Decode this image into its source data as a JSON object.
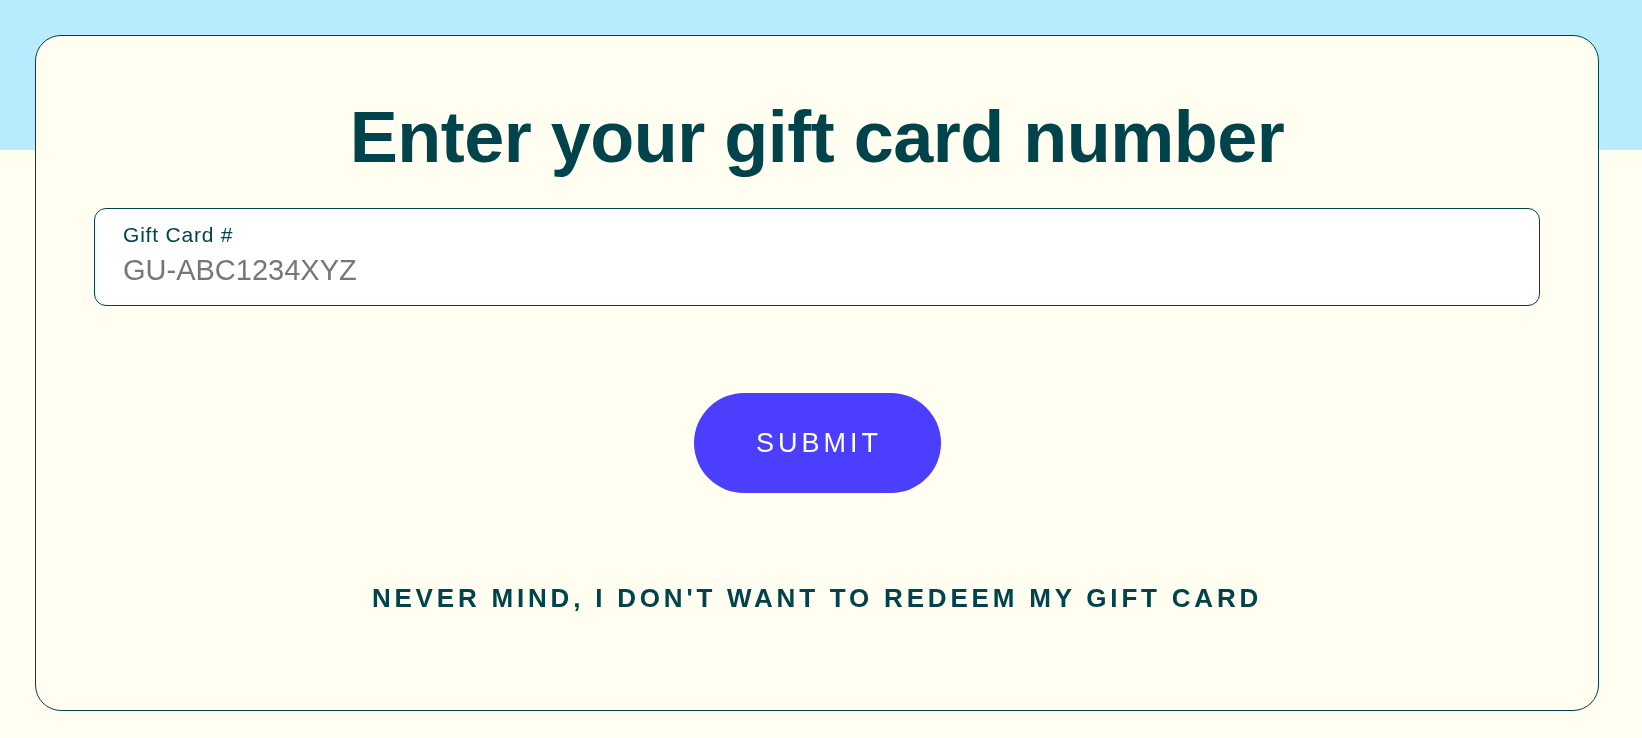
{
  "title": "Enter your gift card number",
  "gift_card_field": {
    "label": "Gift Card #",
    "placeholder": "GU-ABC1234XYZ"
  },
  "submit_button": {
    "label": "SUBMIT"
  },
  "cancel_link": {
    "label": "NEVER MIND, I DON'T WANT TO REDEEM MY GIFT CARD"
  }
}
